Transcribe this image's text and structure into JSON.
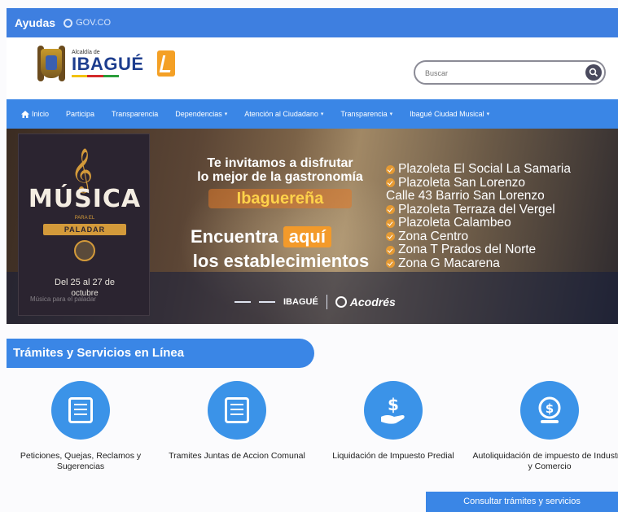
{
  "topbar": {
    "ayudas": "Ayudas",
    "gov": "GOV.CO"
  },
  "header": {
    "logo_small": "Alcaldía de",
    "logo_name": "IBAGUÉ",
    "search_placeholder": "Buscar"
  },
  "nav": {
    "items": [
      {
        "label": "Inicio",
        "dropdown": false
      },
      {
        "label": "Participa",
        "dropdown": false
      },
      {
        "label": "Transparencia",
        "dropdown": false
      },
      {
        "label": "Dependencias",
        "dropdown": true
      },
      {
        "label": "Atención al Ciudadano",
        "dropdown": true
      },
      {
        "label": "Transparencia",
        "dropdown": true
      },
      {
        "label": "Ibagué Ciudad Musical",
        "dropdown": true
      }
    ]
  },
  "banner": {
    "poster_title": "MÚSICA",
    "poster_para": "PARA EL",
    "poster_paladar": "PALADAR",
    "poster_date": "Del 25 al 27 de",
    "poster_date2": "octubre",
    "poster_sub": "Música para el paladar",
    "invite_line1": "Te invitamos a disfrutar",
    "invite_line2": "lo mejor de la gastronomía",
    "ibaguerena": "Ibaguereña",
    "encuentra": "Encuentra",
    "aqui": "aquí",
    "establecimientos": "los establecimientos",
    "places": [
      {
        "name": "Plazoleta El Social La Samaria",
        "sub": ""
      },
      {
        "name": "Plazoleta San Lorenzo",
        "sub": "Calle 43 Barrio San Lorenzo"
      },
      {
        "name": "Plazoleta Terraza del Vergel",
        "sub": ""
      },
      {
        "name": "Plazoleta Calambeo",
        "sub": ""
      },
      {
        "name": "Zona Centro",
        "sub": ""
      },
      {
        "name": "Zona T Prados del Norte",
        "sub": ""
      },
      {
        "name": "Zona G Macarena",
        "sub": ""
      }
    ],
    "footer_ibague": "IBAGUÉ",
    "footer_acodres": "Acodrés"
  },
  "section": {
    "title": "Trámites y Servicios en Línea"
  },
  "services": [
    {
      "label": "Peticiones, Quejas, Reclamos y Sugerencias",
      "icon": "document-list-icon"
    },
    {
      "label": "Tramites Juntas de Accion Comunal",
      "icon": "document-list-icon"
    },
    {
      "label": "Liquidación de Impuesto Predial",
      "icon": "hand-dollar-icon"
    },
    {
      "label": "Autoliquidación de impuesto de Industria y Comercio",
      "icon": "dollar-coin-icon"
    }
  ],
  "consult_button": "Consultar trámites y servicios",
  "colors": {
    "primary": "#3a86e6",
    "topbar": "#3e7fe0",
    "accent_orange": "#f39a2a"
  }
}
